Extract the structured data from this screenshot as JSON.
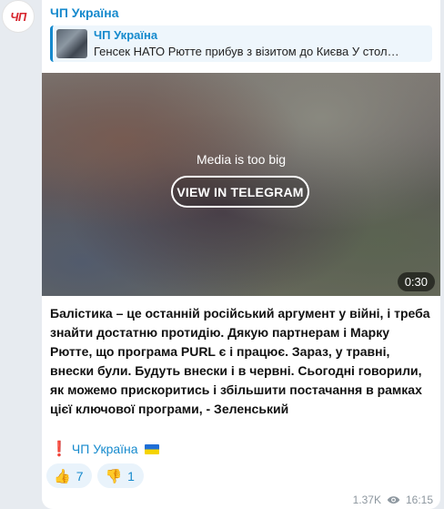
{
  "avatar": {
    "text": "ЧП",
    "color": "#d7262e"
  },
  "channel": {
    "name": "ЧП Україна"
  },
  "reply": {
    "title": "ЧП Україна",
    "text": "Генсек НАТО Рютте прибув з візитом до Києва У стол…",
    "thumbnail_icon": "photo-thumbnail"
  },
  "media": {
    "message": "Media is too big",
    "button_label": "VIEW IN TELEGRAM",
    "duration": "0:30"
  },
  "post": {
    "text": "Балістика – це останній російський аргумент у війні, і треба знайти достатню протидію. Дякую партнерам і Марку Рютте, що програма PURL є і працює. Зараз, у травні, внески були. Будуть внески і в червні. Сьогодні говорили, як можемо прискоритись і збільшити постачання в рамках цієї ключової програми, - Зеленський",
    "signature_mark": "❗",
    "signature": "ЧП Україна"
  },
  "reactions": [
    {
      "emoji": "👍",
      "count": "7"
    },
    {
      "emoji": "👎",
      "count": "1"
    }
  ],
  "meta": {
    "views": "1.37K",
    "time": "16:15",
    "view_icon": "eye-icon"
  },
  "colors": {
    "accent": "#168acd",
    "background": "#e7ebf0",
    "bubble": "#ffffff"
  }
}
